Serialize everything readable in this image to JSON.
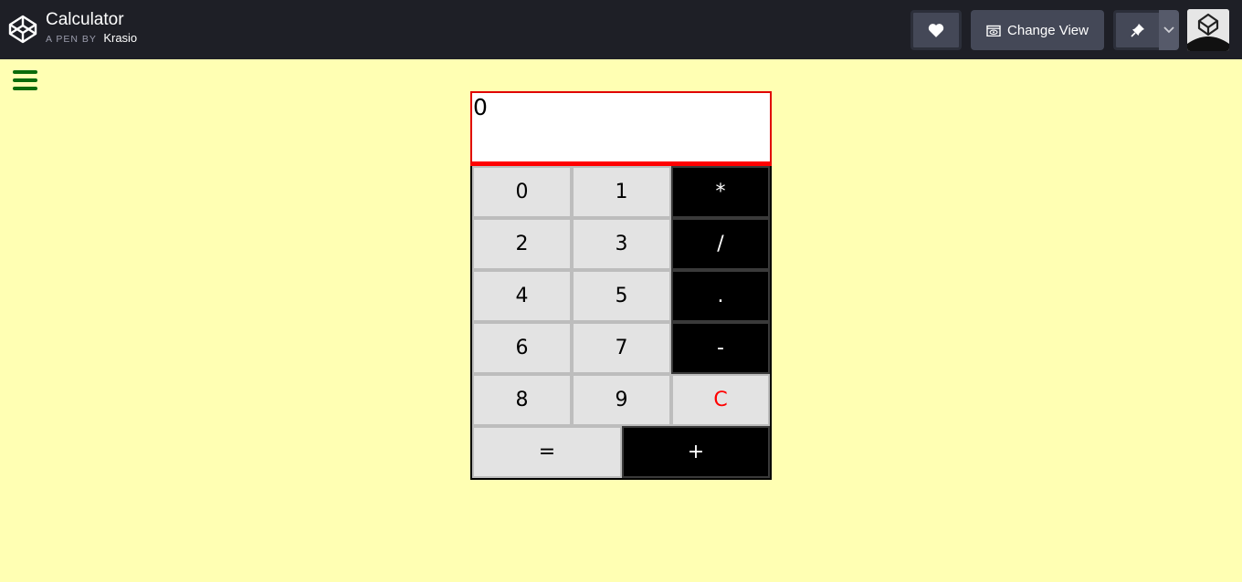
{
  "header": {
    "title": "Calculator",
    "by_label": "A PEN BY",
    "author": "Krasio",
    "change_view_label": "Change View",
    "icons": [
      "codepen-logo-icon",
      "heart-icon",
      "change-view-icon",
      "pin-icon",
      "chevron-down-icon",
      "avatar"
    ]
  },
  "colors": {
    "page_background": "#ffffb3",
    "topbar": "#1e1f26",
    "display_border": "#ff0000",
    "operator_key": "#000000",
    "number_key": "#e3e3e3",
    "clear_key_text": "#ff0000",
    "menu_icon": "#0a6b0a"
  },
  "calculator": {
    "display_value": "0",
    "keys": {
      "k0": "0",
      "k1": "1",
      "mul": "*",
      "k2": "2",
      "k3": "3",
      "div": "/",
      "k4": "4",
      "k5": "5",
      "dot": ".",
      "k6": "6",
      "k7": "7",
      "minus": "-",
      "k8": "8",
      "k9": "9",
      "clear": "C",
      "equals": "=",
      "plus": "+"
    }
  }
}
